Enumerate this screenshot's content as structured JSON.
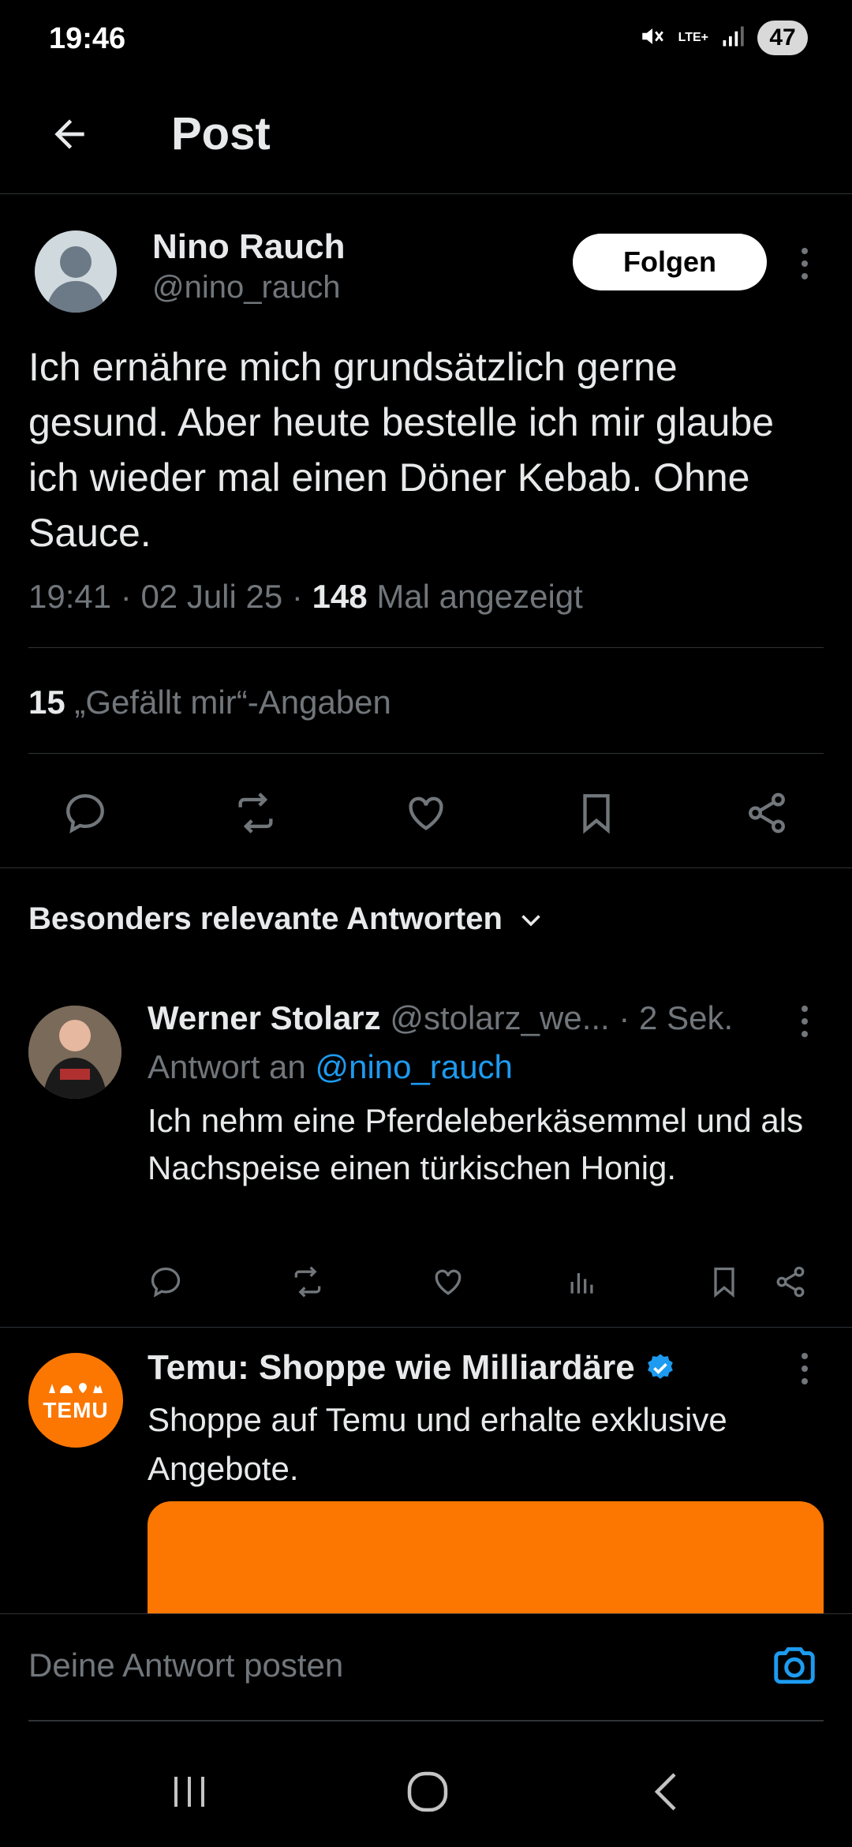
{
  "status_bar": {
    "time": "19:46",
    "network": "LTE+",
    "battery": "47",
    "icons": [
      "mute-icon",
      "network-icon",
      "signal-icon",
      "battery-icon"
    ]
  },
  "header": {
    "title": "Post",
    "back_icon": "arrow-left-icon"
  },
  "post": {
    "author_name": "Nino Rauch",
    "author_handle": "@nino_rauch",
    "follow_label": "Folgen",
    "text": "Ich ernähre mich grundsätzlich gerne gesund. Aber heute bestelle ich mir glaube ich wieder mal einen Döner Kebab. Ohne Sauce.",
    "time": "19:41",
    "date": "02 Juli 25",
    "views_count": "148",
    "views_label": "Mal angezeigt",
    "likes_count": "15",
    "likes_label": "„Gefällt mir“-Angaben",
    "actions": [
      "reply-icon",
      "repost-icon",
      "like-icon",
      "bookmark-icon",
      "share-icon"
    ]
  },
  "replies_section": {
    "sort_label": "Besonders relevante Antworten"
  },
  "reply": {
    "name": "Werner Stolarz",
    "handle": "@stolarz_we...",
    "time": "· 2 Sek.",
    "reply_to_prefix": "Antwort an",
    "reply_to_handle": "@nino_rauch",
    "text": "Ich nehm eine Pferdeleberkäsemmel und als Nachspeise einen türkischen Honig.",
    "actions": [
      "reply-icon",
      "repost-icon",
      "like-icon",
      "views-icon",
      "bookmark-icon",
      "share-icon"
    ]
  },
  "ad": {
    "name": "Temu: Shoppe wie Milliardäre",
    "logo_text": "TEMU",
    "text": "Shoppe auf Temu und erhalte exklusive Angebote.",
    "brand_color": "#fb7701"
  },
  "composer": {
    "placeholder": "Deine Antwort posten"
  },
  "colors": {
    "background": "#000000",
    "text": "#e7e9ea",
    "muted": "#71767b",
    "link": "#1d9bf0",
    "divider": "#2f3336"
  }
}
